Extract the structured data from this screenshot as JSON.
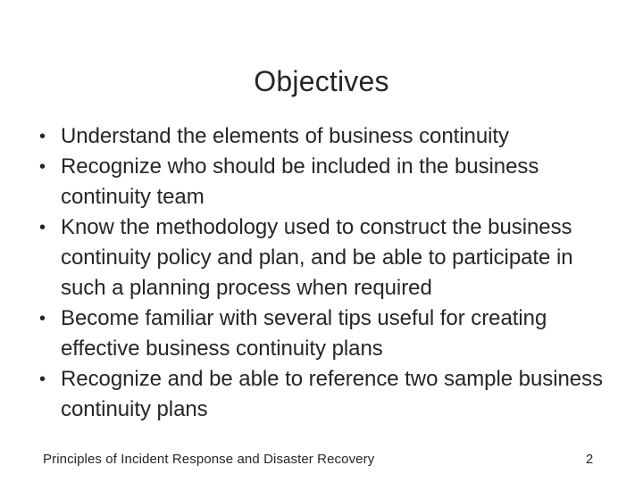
{
  "slide": {
    "title": "Objectives",
    "background_color": "#ffffff",
    "text_color": "#262626",
    "bullet_glyph": "•",
    "bullets": [
      {
        "text": "Understand the elements of business continuity"
      },
      {
        "text": "Recognize who should be included in the business continuity team"
      },
      {
        "text": "Know the methodology used to construct the business continuity policy and plan, and be able to participate in such a planning process when required"
      },
      {
        "text": "Become familiar with several tips useful for creating effective business continuity plans"
      },
      {
        "text": "Recognize and be able to reference two sample business continuity plans"
      }
    ],
    "footer": {
      "title": "Principles of Incident Response and Disaster Recovery",
      "page_number": "2"
    }
  }
}
